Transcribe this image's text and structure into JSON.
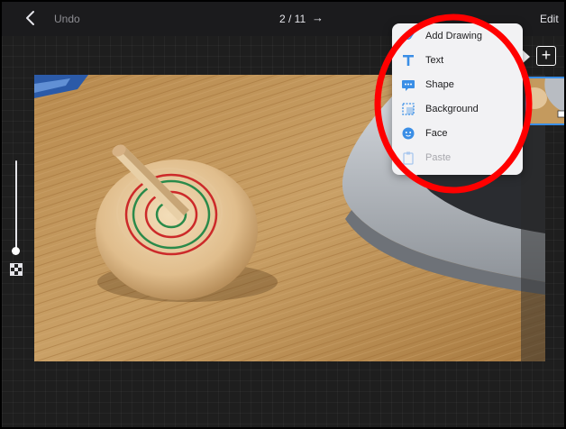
{
  "toolbar": {
    "back_icon": "chevron-left-icon",
    "undo_label": "Undo",
    "page_indicator": "2 / 11",
    "next_icon": "→",
    "edit_label": "Edit",
    "add_label": "+"
  },
  "insert_menu": {
    "items": [
      {
        "label": "Add Drawing",
        "icon": "pen-icon",
        "enabled": true
      },
      {
        "label": "Text",
        "icon": "text-icon",
        "enabled": true
      },
      {
        "label": "Shape",
        "icon": "shape-icon",
        "enabled": true
      },
      {
        "label": "Background",
        "icon": "background-icon",
        "enabled": true
      },
      {
        "label": "Face",
        "icon": "face-icon",
        "enabled": true
      },
      {
        "label": "Paste",
        "icon": "clipboard-icon",
        "enabled": false
      }
    ]
  },
  "colors": {
    "accent": "#3a8ee6",
    "annotation": "#ff0000",
    "menu_background": "#f2f2f4"
  },
  "photo": {
    "subject": "wooden spinning top on wooden desk"
  }
}
